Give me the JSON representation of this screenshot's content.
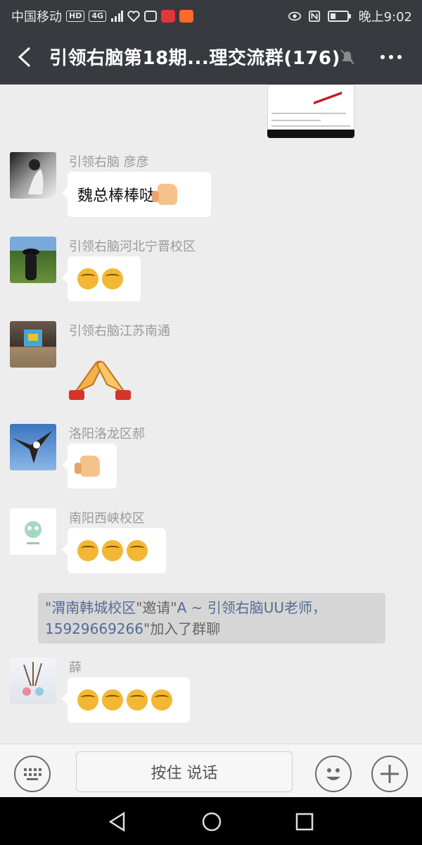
{
  "status_bar": {
    "carrier": "中国移动",
    "hd": "HD",
    "network": "4G",
    "red_badge": "小红书",
    "time": "晚上9:02"
  },
  "title_bar": {
    "title": "引领右脑第18期...理交流群(176)"
  },
  "messages": [
    {
      "sender": "引领右脑  彦彦",
      "text": "魏总棒棒哒",
      "emoji": "thumbs-up-icon"
    },
    {
      "sender": "引领右脑河北宁晋校区",
      "emojis": 2,
      "emoji": "blushing-face-icon"
    },
    {
      "sender": "引领右脑江苏南通",
      "emoji": "clapping-hands-icon"
    },
    {
      "sender": "洛阳洛龙区郝",
      "emoji": "thumbs-up-icon"
    },
    {
      "sender": "南阳西峡校区",
      "emojis": 3,
      "emoji": "blushing-face-icon"
    },
    {
      "sender": "薛",
      "emojis": 4,
      "emoji": "blushing-face-icon"
    }
  ],
  "system_message": {
    "q1": "\"",
    "inviter": "渭南韩城校区",
    "q2": "\"邀请\"",
    "invitee": "A ~ 引领右脑UU老师，15929669266",
    "q3": "\"",
    "suffix": "加入了群聊"
  },
  "input_bar": {
    "hold_to_talk": "按住 说话"
  },
  "colors": {
    "header_bg": "#393a3f",
    "chat_bg": "#ededed",
    "link": "#576b95"
  }
}
